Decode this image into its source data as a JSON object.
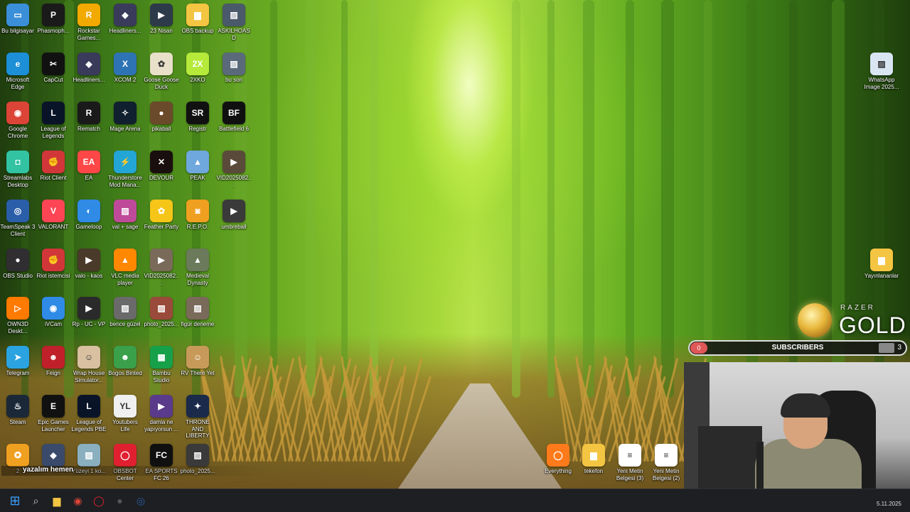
{
  "desktop": {
    "icons": [
      {
        "label": "Bu bilgisayar",
        "icon": "monitor-icon",
        "color": "#3b8fd9"
      },
      {
        "label": "Phasmoph...",
        "icon": "phasmophobia-icon",
        "color": "#1a1a1a"
      },
      {
        "label": "Rockstar Games...",
        "icon": "rockstar-icon",
        "color": "#f2a900"
      },
      {
        "label": "Headliners...",
        "icon": "game-icon",
        "color": "#3a3a5a"
      },
      {
        "label": "23 Nisan",
        "icon": "video-icon",
        "color": "#2d3a4a"
      },
      {
        "label": "OBS backup",
        "icon": "folder-icon",
        "color": "#f4c542"
      },
      {
        "label": "ASKILHOASD",
        "icon": "image-icon",
        "color": "#4a5a6a"
      },
      {
        "label": "Microsoft Edge",
        "icon": "edge-icon",
        "color": "#1c8fd6"
      },
      {
        "label": "CapCut",
        "icon": "capcut-icon",
        "color": "#111111"
      },
      {
        "label": "Headliners...",
        "icon": "game-icon",
        "color": "#3a3a5a"
      },
      {
        "label": "XCOM 2",
        "icon": "xcom-icon",
        "color": "#2e74b5"
      },
      {
        "label": "Goose Goose Duck",
        "icon": "goose-icon",
        "color": "#e8e0c8"
      },
      {
        "label": "2XKO",
        "icon": "2xko-icon",
        "color": "#b5e93a"
      },
      {
        "label": "bu son",
        "icon": "image-icon",
        "color": "#5a6a7a"
      },
      {
        "label": "Google Chrome",
        "icon": "chrome-icon",
        "color": "#db4437"
      },
      {
        "label": "League of Legends",
        "icon": "lol-icon",
        "color": "#0a1428"
      },
      {
        "label": "Rematch",
        "icon": "rematch-icon",
        "color": "#1a1a1a"
      },
      {
        "label": "Mage Arena",
        "icon": "mage-arena-icon",
        "color": "#10202e"
      },
      {
        "label": "pikaball",
        "icon": "pikaball-icon",
        "color": "#6a4a2a"
      },
      {
        "label": "Registr",
        "icon": "registr-icon",
        "color": "#111111"
      },
      {
        "label": "Battlefield 6",
        "icon": "battlefield-icon",
        "color": "#101010"
      },
      {
        "label": "Streamlabs Desktop",
        "icon": "streamlabs-icon",
        "color": "#31c3a2"
      },
      {
        "label": "Riot Client",
        "icon": "riot-icon",
        "color": "#d13639"
      },
      {
        "label": "EA",
        "icon": "ea-icon",
        "color": "#ff4747"
      },
      {
        "label": "Thunderstore Mod Mana...",
        "icon": "thunderstore-icon",
        "color": "#23a6d5"
      },
      {
        "label": "DEVOUR",
        "icon": "devour-icon",
        "color": "#1a0f0f"
      },
      {
        "label": "PEAK",
        "icon": "peak-icon",
        "color": "#6fa8dc"
      },
      {
        "label": "VID2025082...",
        "icon": "video-icon",
        "color": "#5a4a3a"
      },
      {
        "label": "TeamSpeak 3 Client",
        "icon": "teamspeak-icon",
        "color": "#2b5ea8"
      },
      {
        "label": "VALORANT",
        "icon": "valorant-icon",
        "color": "#fd4556"
      },
      {
        "label": "Gameloop",
        "icon": "gameloop-icon",
        "color": "#2f8be6"
      },
      {
        "label": "val + sage",
        "icon": "image-icon",
        "color": "#c04a9a"
      },
      {
        "label": "Feather Party",
        "icon": "feather-party-icon",
        "color": "#f5c518"
      },
      {
        "label": "R.E.P.O.",
        "icon": "repo-icon",
        "color": "#f0a020"
      },
      {
        "label": "umbreball",
        "icon": "video-icon",
        "color": "#3a3a3a"
      },
      {
        "label": "OBS Studio",
        "icon": "obs-icon",
        "color": "#302e31"
      },
      {
        "label": "Riot istemcisi",
        "icon": "riot-icon",
        "color": "#d13639"
      },
      {
        "label": "valo - kaos",
        "icon": "video-icon",
        "color": "#4a3a2a"
      },
      {
        "label": "VLC media player",
        "icon": "vlc-icon",
        "color": "#ff8800"
      },
      {
        "label": "VID2025082...",
        "icon": "video-icon",
        "color": "#7a6a5a"
      },
      {
        "label": "Medieval Dynasty",
        "icon": "medieval-dynasty-icon",
        "color": "#6a7a5a"
      },
      {
        "label": "OWN3D Deskt...",
        "icon": "own3d-icon",
        "color": "#ff7a00"
      },
      {
        "label": "iVCam",
        "icon": "ivcam-icon",
        "color": "#2f8be6"
      },
      {
        "label": "Rp - UC - VP",
        "icon": "video-icon",
        "color": "#2a2a2a"
      },
      {
        "label": "bence güzel",
        "icon": "image-icon",
        "color": "#6a6a6a"
      },
      {
        "label": "photo_2025...",
        "icon": "image-icon",
        "color": "#9a4a3a"
      },
      {
        "label": "figür deneme",
        "icon": "image-icon",
        "color": "#7a6a5a"
      },
      {
        "label": "Telegram",
        "icon": "telegram-icon",
        "color": "#2aa3e0"
      },
      {
        "label": "Feign",
        "icon": "feign-icon",
        "color": "#c0202a"
      },
      {
        "label": "Wrap House Simulator...",
        "icon": "wrap-house-icon",
        "color": "#d8c0a0"
      },
      {
        "label": "Bogos Binted",
        "icon": "alien-icon",
        "color": "#3aa04a"
      },
      {
        "label": "Bambu Studio",
        "icon": "bambu-icon",
        "color": "#17a04a"
      },
      {
        "label": "RV There Yet",
        "icon": "rv-icon",
        "color": "#c89a5a"
      },
      {
        "label": "Steam",
        "icon": "steam-icon",
        "color": "#1b2838"
      },
      {
        "label": "Epic Games Launcher",
        "icon": "epic-icon",
        "color": "#111111"
      },
      {
        "label": "League of Legends PBE",
        "icon": "lol-icon",
        "color": "#0a1428"
      },
      {
        "label": "Youtubers Life",
        "icon": "youtubers-life-icon",
        "color": "#f0f0f0"
      },
      {
        "label": "damla ne yapıyorsun ...",
        "icon": "video-icon",
        "color": "#5a3a8a"
      },
      {
        "label": "THRONE AND LIBERTY",
        "icon": "throne-icon",
        "color": "#1a2a4a"
      },
      {
        "label": "2",
        "icon": "csgo-icon",
        "color": "#f0a020"
      },
      {
        "label": "",
        "icon": "game-icon",
        "color": "#3a4a6a"
      },
      {
        "label": "Yüzeyi 1 ko...",
        "icon": "image-icon",
        "color": "#8ab0c0"
      },
      {
        "label": "OBSBOT Center",
        "icon": "obsbot-icon",
        "color": "#e02030"
      },
      {
        "label": "EA SPORTS FC 26",
        "icon": "fc26-icon",
        "color": "#101010"
      },
      {
        "label": "photo_2025...",
        "icon": "image-icon",
        "color": "#3a3a3a"
      }
    ],
    "right_icons": [
      {
        "label": "WhatsApp Image 2025...",
        "icon": "image-icon",
        "color": "#d9e6f2"
      },
      {
        "label": "Yayınlananlar",
        "icon": "folder-icon",
        "color": "#f4c542"
      }
    ],
    "bottom_icons": [
      {
        "label": "Everything",
        "icon": "everything-icon",
        "color": "#ff7a1a"
      },
      {
        "label": "tekefon",
        "icon": "folder-icon",
        "color": "#f4c542"
      },
      {
        "label": "Yeni Metin Belgesi (3)",
        "icon": "text-file-icon",
        "color": "#ffffff"
      },
      {
        "label": "Yeni Metin Belgesi (2)",
        "icon": "text-file-icon",
        "color": "#ffffff"
      }
    ]
  },
  "overlay": {
    "razer_brand": "RAZER",
    "razer_gold": "GOLD",
    "subscribers_title": "SUBSCRIBERS",
    "subscribers_start": "0",
    "subscribers_goal": "3",
    "ticker_text": "yazalım hemen"
  },
  "taskbar": {
    "items": [
      {
        "icon": "windows-start-icon",
        "color": "#3aa0ff"
      },
      {
        "icon": "search-icon",
        "color": "#cccccc"
      },
      {
        "icon": "file-explorer-icon",
        "color": "#f4c542"
      },
      {
        "icon": "chrome-icon",
        "color": "#db4437"
      },
      {
        "icon": "obsbot-icon",
        "color": "#e02030"
      },
      {
        "icon": "obs-icon",
        "color": "#555555"
      },
      {
        "icon": "teamspeak-icon",
        "color": "#2b5ea8"
      }
    ],
    "date": "5.11.2025"
  }
}
